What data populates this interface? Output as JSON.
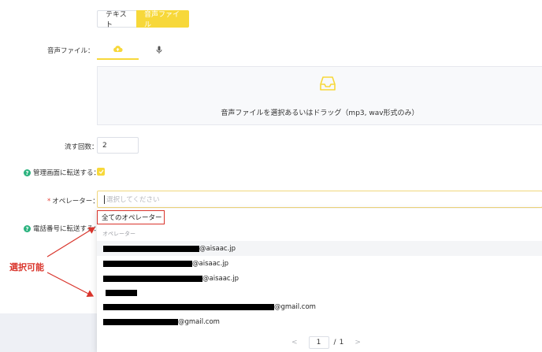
{
  "mode_toggle": {
    "text_label": "テキスト",
    "audio_label": "音声ファイル"
  },
  "audio_file": {
    "label": "音声ファイル："
  },
  "upload": {
    "text": "音声ファイルを選択あるいはドラッグ（mp3, wav形式のみ）"
  },
  "play_count": {
    "label": "流す回数：",
    "value": "2"
  },
  "transfer_admin": {
    "label": "管理画面に転送する：",
    "checked": true
  },
  "operator": {
    "label": "オペレーター：",
    "placeholder": "選択してください"
  },
  "transfer_phone": {
    "label": "電話番号に転送する："
  },
  "dropdown": {
    "all_operators": "全てのオペレーター",
    "group_title": "オペレーター",
    "items": [
      {
        "suffix": "@aisaac.jp"
      },
      {
        "suffix": "@aisaac.jp"
      },
      {
        "suffix": "@aisaac.jp"
      },
      {
        "suffix": ""
      },
      {
        "suffix": "@gmail.com"
      },
      {
        "suffix": "@gmail.com"
      }
    ]
  },
  "pagination": {
    "current": "1",
    "separator": "/",
    "total": "1"
  },
  "annotation": {
    "text": "選択可能"
  },
  "colors": {
    "accent": "#f7d83a",
    "annotation": "#d9342b",
    "help": "#2cb37f"
  }
}
